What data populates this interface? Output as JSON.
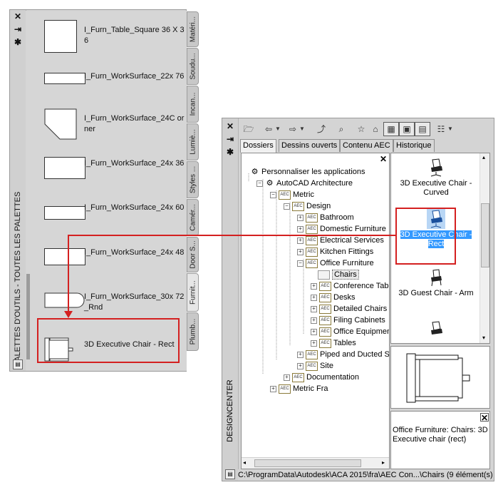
{
  "tool_palette": {
    "title": "PALETTES D'OUTILS - TOUTES LES PALETTES",
    "buttons": {
      "close": "✕",
      "pin": "⇥",
      "properties": "✱"
    },
    "tools": [
      {
        "label": "I_Furn_Table_Square 36 X 36"
      },
      {
        "label": "I_Furn_WorkSurface_22x 76"
      },
      {
        "label": "I_Furn_WorkSurface_24C orner"
      },
      {
        "label": "I_Furn_WorkSurface_24x 36"
      },
      {
        "label": "I_Furn_WorkSurface_24x 60"
      },
      {
        "label": "I_Furn_WorkSurface_24x 48"
      },
      {
        "label": "I_Furn_WorkSurface_30x 72_Rnd"
      },
      {
        "label": "3D Executive Chair - Rect"
      }
    ],
    "tabs": [
      "Matéri...",
      "Soudu...",
      "Incan...",
      "Lumiè...",
      "Styles ...",
      "Camér...",
      "Door S...",
      "Furnit...",
      "Plumb..."
    ],
    "active_tab": "Furnit..."
  },
  "design_center": {
    "title": "DESIGNCENTER",
    "buttons": {
      "close": "✕",
      "pin": "⇥",
      "properties": "✱"
    },
    "tabs": [
      "Dossiers",
      "Dessins ouverts",
      "Contenu AEC",
      "Historique"
    ],
    "active_tab": "Dossiers",
    "tree": [
      {
        "label": "Personnaliser les applications",
        "level": 0,
        "icon": "globe-icon",
        "expander": ""
      },
      {
        "label": "AutoCAD Architecture",
        "level": 1,
        "icon": "globe-icon",
        "expander": "−"
      },
      {
        "label": "Metric",
        "level": 2,
        "icon": "aec-folder-icon",
        "expander": "−"
      },
      {
        "label": "Design",
        "level": 3,
        "icon": "aec-folder-icon",
        "expander": "−"
      },
      {
        "label": "Bathroom",
        "level": 4,
        "icon": "aec-folder-icon",
        "expander": "+"
      },
      {
        "label": "Domestic Furniture",
        "level": 4,
        "icon": "aec-folder-icon",
        "expander": "+"
      },
      {
        "label": "Electrical Services",
        "level": 4,
        "icon": "aec-folder-icon",
        "expander": "+"
      },
      {
        "label": "Kitchen Fittings",
        "level": 4,
        "icon": "aec-folder-icon",
        "expander": "+"
      },
      {
        "label": "Office Furniture",
        "level": 4,
        "icon": "aec-folder-icon",
        "expander": "−"
      },
      {
        "label": "Chairs",
        "level": 5,
        "icon": "open-folder-icon",
        "expander": "",
        "selected": true
      },
      {
        "label": "Conference Table &",
        "level": 5,
        "icon": "aec-folder-icon",
        "expander": "+"
      },
      {
        "label": "Desks",
        "level": 5,
        "icon": "aec-folder-icon",
        "expander": "+"
      },
      {
        "label": "Detailed Chairs",
        "level": 5,
        "icon": "aec-folder-icon",
        "expander": "+"
      },
      {
        "label": "Filing Cabinets",
        "level": 5,
        "icon": "aec-folder-icon",
        "expander": "+"
      },
      {
        "label": "Office Equipment",
        "level": 5,
        "icon": "aec-folder-icon",
        "expander": "+"
      },
      {
        "label": "Tables",
        "level": 5,
        "icon": "aec-folder-icon",
        "expander": "+"
      },
      {
        "label": "Piped and Ducted Serv",
        "level": 4,
        "icon": "aec-folder-icon",
        "expander": "+"
      },
      {
        "label": "Site",
        "level": 4,
        "icon": "aec-folder-icon",
        "expander": "+"
      },
      {
        "label": "Documentation",
        "level": 3,
        "icon": "aec-folder-icon",
        "expander": "+"
      },
      {
        "label": "Metric Fra",
        "level": 2,
        "icon": "aec-folder-icon",
        "expander": "+"
      }
    ],
    "folder_badge": "AEC",
    "content_items": [
      {
        "label": "3D Executive Chair - Curved",
        "selected": false
      },
      {
        "label": "3D Executive Chair - Rect",
        "selected": true
      },
      {
        "label": "3D Guest Chair - Arm",
        "selected": false
      }
    ],
    "description": "Office Furniture: Chairs: 3D Executive chair (rect)",
    "status_path": "C:\\ProgramData\\Autodesk\\ACA 2015\\fra\\AEC Con...\\Chairs (9 élément(s))"
  },
  "colors": {
    "highlight": "#d42020",
    "selection": "#3399ff"
  }
}
